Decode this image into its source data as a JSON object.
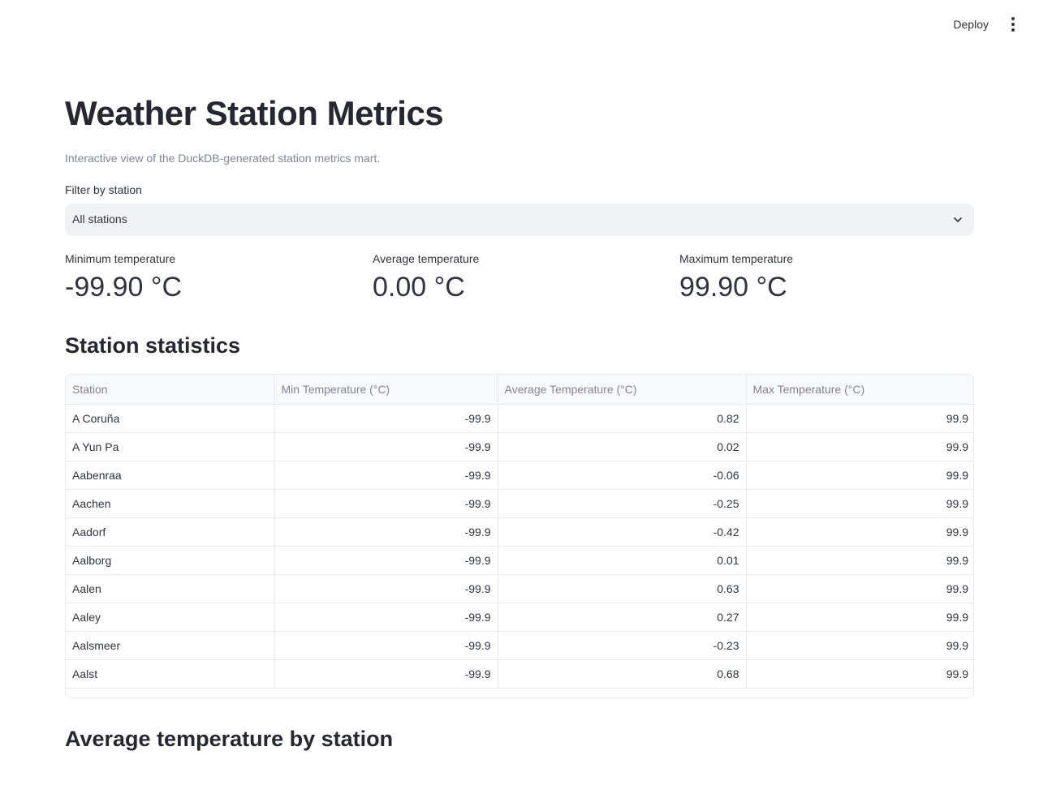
{
  "header": {
    "deploy_label": "Deploy",
    "menu_icon": "vertical-ellipsis-icon"
  },
  "page": {
    "title": "Weather Station Metrics",
    "caption": "Interactive view of the DuckDB-generated station metrics mart."
  },
  "filter": {
    "label": "Filter by station",
    "selected": "All stations",
    "icon": "chevron-down-icon"
  },
  "metrics": [
    {
      "label": "Minimum temperature",
      "value": "-99.90 °C"
    },
    {
      "label": "Average temperature",
      "value": "0.00 °C"
    },
    {
      "label": "Maximum temperature",
      "value": "99.90 °C"
    }
  ],
  "stats": {
    "heading": "Station statistics",
    "columns": [
      "Station",
      "Min Temperature (°C)",
      "Average Temperature (°C)",
      "Max Temperature (°C)"
    ],
    "rows": [
      [
        "A Coruña",
        "-99.9",
        "0.82",
        "99.9"
      ],
      [
        "A Yun Pa",
        "-99.9",
        "0.02",
        "99.9"
      ],
      [
        "Aabenraa",
        "-99.9",
        "-0.06",
        "99.9"
      ],
      [
        "Aachen",
        "-99.9",
        "-0.25",
        "99.9"
      ],
      [
        "Aadorf",
        "-99.9",
        "-0.42",
        "99.9"
      ],
      [
        "Aalborg",
        "-99.9",
        "0.01",
        "99.9"
      ],
      [
        "Aalen",
        "-99.9",
        "0.63",
        "99.9"
      ],
      [
        "Aaley",
        "-99.9",
        "0.27",
        "99.9"
      ],
      [
        "Aalsmeer",
        "-99.9",
        "-0.23",
        "99.9"
      ],
      [
        "Aalst",
        "-99.9",
        "0.68",
        "99.9"
      ]
    ]
  },
  "chart_section": {
    "heading": "Average temperature by station"
  }
}
